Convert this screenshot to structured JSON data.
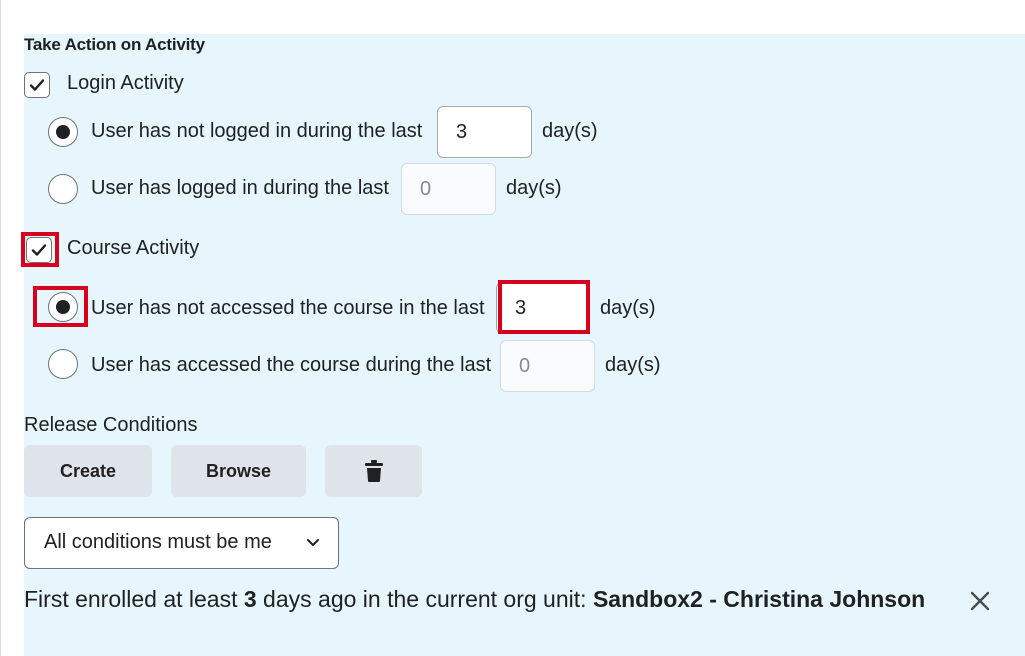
{
  "section_title": "Take Action on Activity",
  "login_activity": {
    "label": "Login Activity",
    "checked": true,
    "options": [
      {
        "label": "User has not logged in during the last",
        "selected": true,
        "value": "3",
        "unit": "day(s)"
      },
      {
        "label": "User has logged in during the last",
        "selected": false,
        "value": "0",
        "unit": "day(s)"
      }
    ]
  },
  "course_activity": {
    "label": "Course Activity",
    "checked": true,
    "options": [
      {
        "label": "User has not accessed the course in the last",
        "selected": true,
        "value": "3",
        "unit": "day(s)"
      },
      {
        "label": "User has accessed the course during the last",
        "selected": false,
        "value": "0",
        "unit": "day(s)"
      }
    ]
  },
  "release_conditions": {
    "heading": "Release Conditions",
    "create_label": "Create",
    "browse_label": "Browse",
    "delete_icon": "trash-icon",
    "select_value": "All conditions must be me",
    "condition": {
      "prefix": "First enrolled at least ",
      "days": "3",
      "middle": " days ago in the current org unit: ",
      "org_unit": "Sandbox2 - Christina Johnson"
    }
  },
  "colors": {
    "panel_bg": "#e6f6fc",
    "highlight": "#d7001f",
    "button_bg": "#dfe3ea"
  }
}
